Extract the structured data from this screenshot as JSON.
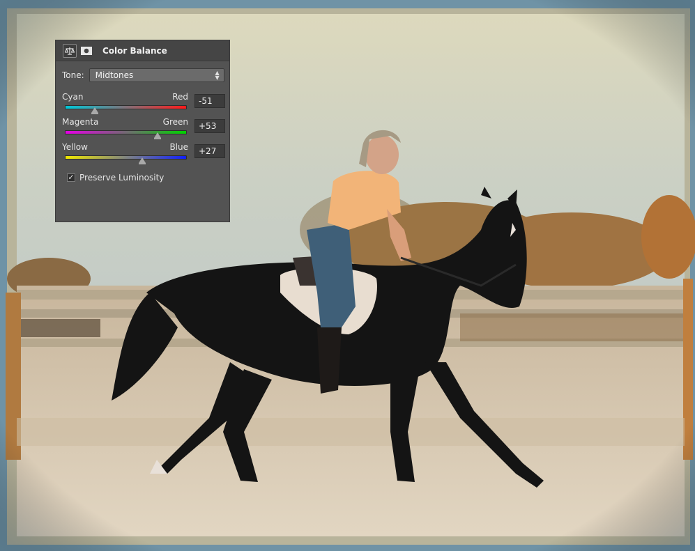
{
  "panel": {
    "title": "Color Balance",
    "icons": [
      "balance-scale-icon",
      "layer-mask-icon"
    ],
    "tone": {
      "label": "Tone:",
      "selected": "Midtones"
    },
    "sliders": [
      {
        "left_label": "Cyan",
        "right_label": "Red",
        "value_text": "-51",
        "value": -51,
        "min": -100,
        "max": 100
      },
      {
        "left_label": "Magenta",
        "right_label": "Green",
        "value_text": "+53",
        "value": 53,
        "min": -100,
        "max": 100
      },
      {
        "left_label": "Yellow",
        "right_label": "Blue",
        "value_text": "+27",
        "value": 27,
        "min": -100,
        "max": 100
      }
    ],
    "preserve_luminosity": {
      "label": "Preserve Luminosity",
      "checked": true
    }
  },
  "colors": {
    "panel_bg": "#535353",
    "header_bg": "#454545",
    "photo_border": "#6a8fa4"
  }
}
